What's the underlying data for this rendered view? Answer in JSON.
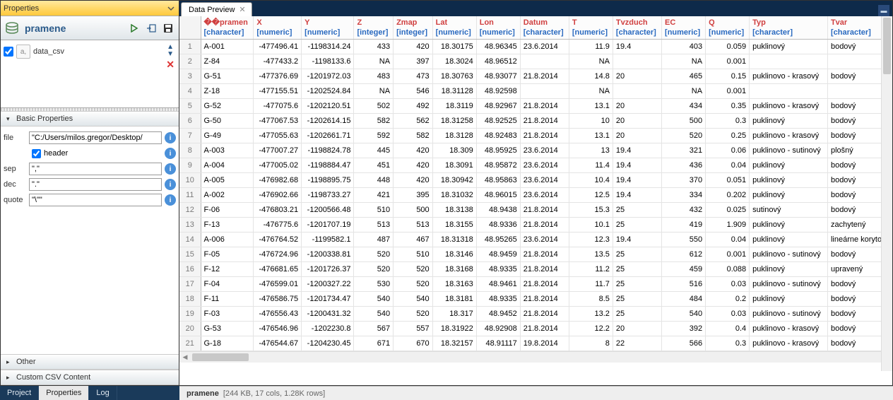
{
  "panel": {
    "title": "Properties"
  },
  "datasource": {
    "name": "pramene"
  },
  "tree": {
    "item": "data_csv"
  },
  "sections": {
    "basic": "Basic Properties",
    "other": "Other",
    "custom": "Custom CSV Content"
  },
  "fields": {
    "file": {
      "label": "file",
      "value": "\"C:/Users/milos.gregor/Desktop/"
    },
    "header": {
      "label": "header"
    },
    "sep": {
      "label": "sep",
      "value": "\",\""
    },
    "dec": {
      "label": "dec",
      "value": "\".\""
    },
    "quote": {
      "label": "quote",
      "value": "\"\\\"\""
    }
  },
  "bottom_tabs": {
    "project": "Project",
    "properties": "Properties",
    "log": "Log"
  },
  "preview_tab": "Data Preview",
  "status": {
    "name": "pramene",
    "info": "[244 KB, 17 cols, 1.28K rows]"
  },
  "columns": [
    {
      "name": "��pramen",
      "type": "[character]",
      "align": "s"
    },
    {
      "name": "X",
      "type": "[numeric]",
      "align": "n"
    },
    {
      "name": "Y",
      "type": "[numeric]",
      "align": "n"
    },
    {
      "name": "Z",
      "type": "[integer]",
      "align": "n"
    },
    {
      "name": "Zmap",
      "type": "[integer]",
      "align": "n"
    },
    {
      "name": "Lat",
      "type": "[numeric]",
      "align": "n"
    },
    {
      "name": "Lon",
      "type": "[numeric]",
      "align": "n"
    },
    {
      "name": "Datum",
      "type": "[character]",
      "align": "s"
    },
    {
      "name": "T",
      "type": "[numeric]",
      "align": "n"
    },
    {
      "name": "Tvzduch",
      "type": "[character]",
      "align": "s"
    },
    {
      "name": "EC",
      "type": "[numeric]",
      "align": "n"
    },
    {
      "name": "Q",
      "type": "[numeric]",
      "align": "n"
    },
    {
      "name": "Typ",
      "type": "[character]",
      "align": "s"
    },
    {
      "name": "Tvar",
      "type": "[character]",
      "align": "s"
    }
  ],
  "rows": [
    [
      "A-001",
      "-477496.41",
      "-1198314.24",
      "433",
      "420",
      "18.30175",
      "48.96345",
      "23.6.2014",
      "11.9",
      "19.4",
      "403",
      "0.059",
      "puklinový",
      "bodový"
    ],
    [
      "Z-84",
      "-477433.2",
      "-1198133.6",
      "NA",
      "397",
      "18.3024",
      "48.96512",
      "",
      "NA",
      "",
      "NA",
      "0.001",
      "",
      ""
    ],
    [
      "G-51",
      "-477376.69",
      "-1201972.03",
      "483",
      "473",
      "18.30763",
      "48.93077",
      "21.8.2014",
      "14.8",
      "20",
      "465",
      "0.15",
      "puklinovo - krasový",
      "bodový"
    ],
    [
      "Z-18",
      "-477155.51",
      "-1202524.84",
      "NA",
      "546",
      "18.31128",
      "48.92598",
      "",
      "NA",
      "",
      "NA",
      "0.001",
      "",
      ""
    ],
    [
      "G-52",
      "-477075.6",
      "-1202120.51",
      "502",
      "492",
      "18.3119",
      "48.92967",
      "21.8.2014",
      "13.1",
      "20",
      "434",
      "0.35",
      "puklinovo - krasový",
      "bodový"
    ],
    [
      "G-50",
      "-477067.53",
      "-1202614.15",
      "582",
      "562",
      "18.31258",
      "48.92525",
      "21.8.2014",
      "10",
      "20",
      "500",
      "0.3",
      "puklinový",
      "bodový"
    ],
    [
      "G-49",
      "-477055.63",
      "-1202661.71",
      "592",
      "582",
      "18.3128",
      "48.92483",
      "21.8.2014",
      "13.1",
      "20",
      "520",
      "0.25",
      "puklinovo - krasový",
      "bodový"
    ],
    [
      "A-003",
      "-477007.27",
      "-1198824.78",
      "445",
      "420",
      "18.309",
      "48.95925",
      "23.6.2014",
      "13",
      "19.4",
      "321",
      "0.06",
      "puklinovo - sutinový",
      "plošný"
    ],
    [
      "A-004",
      "-477005.02",
      "-1198884.47",
      "451",
      "420",
      "18.3091",
      "48.95872",
      "23.6.2014",
      "11.4",
      "19.4",
      "436",
      "0.04",
      "puklinový",
      "bodový"
    ],
    [
      "A-005",
      "-476982.68",
      "-1198895.75",
      "448",
      "420",
      "18.30942",
      "48.95863",
      "23.6.2014",
      "10.4",
      "19.4",
      "370",
      "0.051",
      "puklinový",
      "bodový"
    ],
    [
      "A-002",
      "-476902.66",
      "-1198733.27",
      "421",
      "395",
      "18.31032",
      "48.96015",
      "23.6.2014",
      "12.5",
      "19.4",
      "334",
      "0.202",
      "puklinový",
      "bodový"
    ],
    [
      "F-06",
      "-476803.21",
      "-1200566.48",
      "510",
      "500",
      "18.3138",
      "48.9438",
      "21.8.2014",
      "15.3",
      "25",
      "432",
      "0.025",
      "sutinový",
      "bodový"
    ],
    [
      "F-13",
      "-476775.6",
      "-1201707.19",
      "513",
      "513",
      "18.3155",
      "48.9336",
      "21.8.2014",
      "10.1",
      "25",
      "419",
      "1.909",
      "puklinový",
      "zachytený"
    ],
    [
      "A-006",
      "-476764.52",
      "-1199582.1",
      "487",
      "467",
      "18.31318",
      "48.95265",
      "23.6.2014",
      "12.3",
      "19.4",
      "550",
      "0.04",
      "puklinový",
      "lineárne korytov"
    ],
    [
      "F-05",
      "-476724.96",
      "-1200338.81",
      "520",
      "510",
      "18.3146",
      "48.9459",
      "21.8.2014",
      "13.5",
      "25",
      "612",
      "0.001",
      "puklinovo - sutinový",
      "bodový"
    ],
    [
      "F-12",
      "-476681.65",
      "-1201726.37",
      "520",
      "520",
      "18.3168",
      "48.9335",
      "21.8.2014",
      "11.2",
      "25",
      "459",
      "0.088",
      "puklinový",
      "upravený"
    ],
    [
      "F-04",
      "-476599.01",
      "-1200327.22",
      "530",
      "520",
      "18.3163",
      "48.9461",
      "21.8.2014",
      "11.7",
      "25",
      "516",
      "0.03",
      "puklinovo - sutinový",
      "bodový"
    ],
    [
      "F-11",
      "-476586.75",
      "-1201734.47",
      "540",
      "540",
      "18.3181",
      "48.9335",
      "21.8.2014",
      "8.5",
      "25",
      "484",
      "0.2",
      "puklinový",
      "bodový"
    ],
    [
      "F-03",
      "-476556.43",
      "-1200431.32",
      "540",
      "520",
      "18.317",
      "48.9452",
      "21.8.2014",
      "13.2",
      "25",
      "540",
      "0.03",
      "puklinovo - sutinový",
      "bodový"
    ],
    [
      "G-53",
      "-476546.96",
      "-1202230.8",
      "567",
      "557",
      "18.31922",
      "48.92908",
      "21.8.2014",
      "12.2",
      "20",
      "392",
      "0.4",
      "puklinovo - krasový",
      "bodový"
    ],
    [
      "G-18",
      "-476544.67",
      "-1204230.45",
      "671",
      "670",
      "18.32157",
      "48.91117",
      "19.8.2014",
      "8",
      "22",
      "566",
      "0.3",
      "puklinovo - krasový",
      "bodový"
    ]
  ]
}
